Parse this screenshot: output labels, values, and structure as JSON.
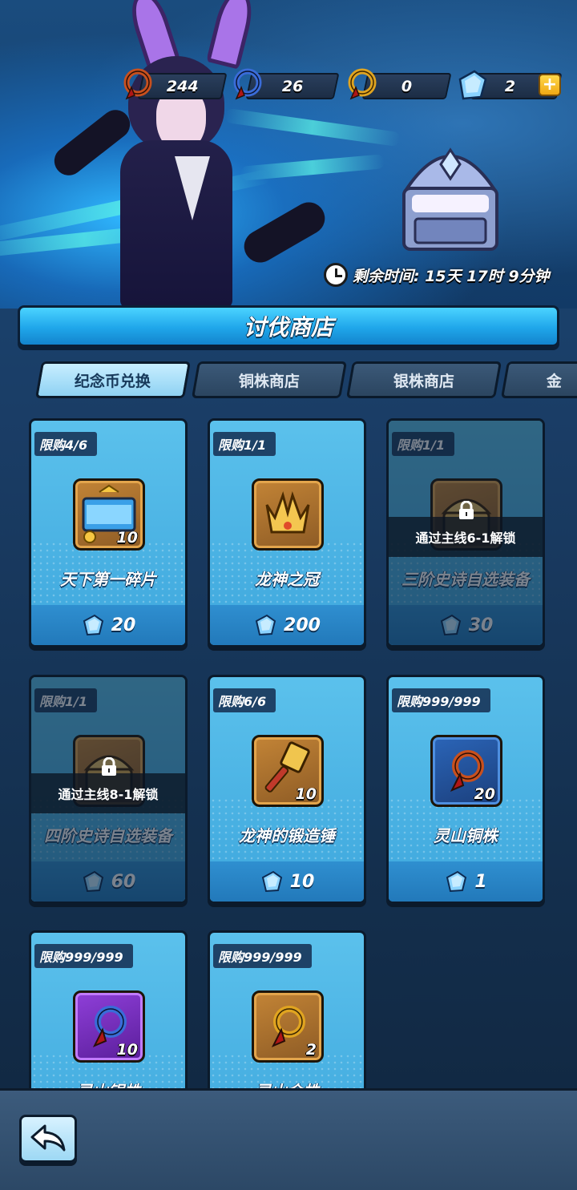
{
  "resources": [
    {
      "name": "copper-coin",
      "value": "244",
      "color": "#c8501e"
    },
    {
      "name": "blue-coin",
      "value": "26",
      "color": "#3a6cd8"
    },
    {
      "name": "gold-coin",
      "value": "0",
      "color": "#e0a420"
    },
    {
      "name": "diamond",
      "value": "2",
      "color": "#7fc8f8"
    }
  ],
  "plus_label": "+",
  "timer": {
    "label": "剩余时间: 15天 17时 9分钟"
  },
  "shop_title": "讨伐商店",
  "tabs": [
    {
      "label": "纪念币兑换",
      "active": true
    },
    {
      "label": "铜株商店",
      "active": false
    },
    {
      "label": "银株商店",
      "active": false
    },
    {
      "label": "金",
      "active": false
    }
  ],
  "items": [
    {
      "limit": "限购4/6",
      "name": "天下第一碎片",
      "qty": "10",
      "price": "20",
      "locked": false,
      "icon": "banner-icon"
    },
    {
      "limit": "限购1/1",
      "name": "龙神之冠",
      "qty": "",
      "price": "200",
      "locked": false,
      "icon": "crown-icon"
    },
    {
      "limit": "限购1/1",
      "name": "三阶史诗自选装备",
      "qty": "",
      "price": "30",
      "locked": true,
      "lock_text": "通过主线6-1解锁",
      "icon": "chest-icon"
    },
    {
      "limit": "限购1/1",
      "name": "四阶史诗自选装备",
      "qty": "",
      "price": "60",
      "locked": true,
      "lock_text": "通过主线8-1解锁",
      "icon": "chest-icon"
    },
    {
      "limit": "限购6/6",
      "name": "龙神的锻造锤",
      "qty": "10",
      "price": "10",
      "locked": false,
      "icon": "hammer-icon"
    },
    {
      "limit": "限购999/999",
      "name": "灵山铜株",
      "qty": "20",
      "price": "1",
      "locked": false,
      "icon": "copper-orb-icon"
    },
    {
      "limit": "限购999/999",
      "name": "灵山银株",
      "qty": "10",
      "price": "",
      "locked": false,
      "icon": "purple-orb-icon"
    },
    {
      "limit": "限购999/999",
      "name": "灵山金株",
      "qty": "2",
      "price": "",
      "locked": false,
      "icon": "gold-orb-icon"
    }
  ]
}
